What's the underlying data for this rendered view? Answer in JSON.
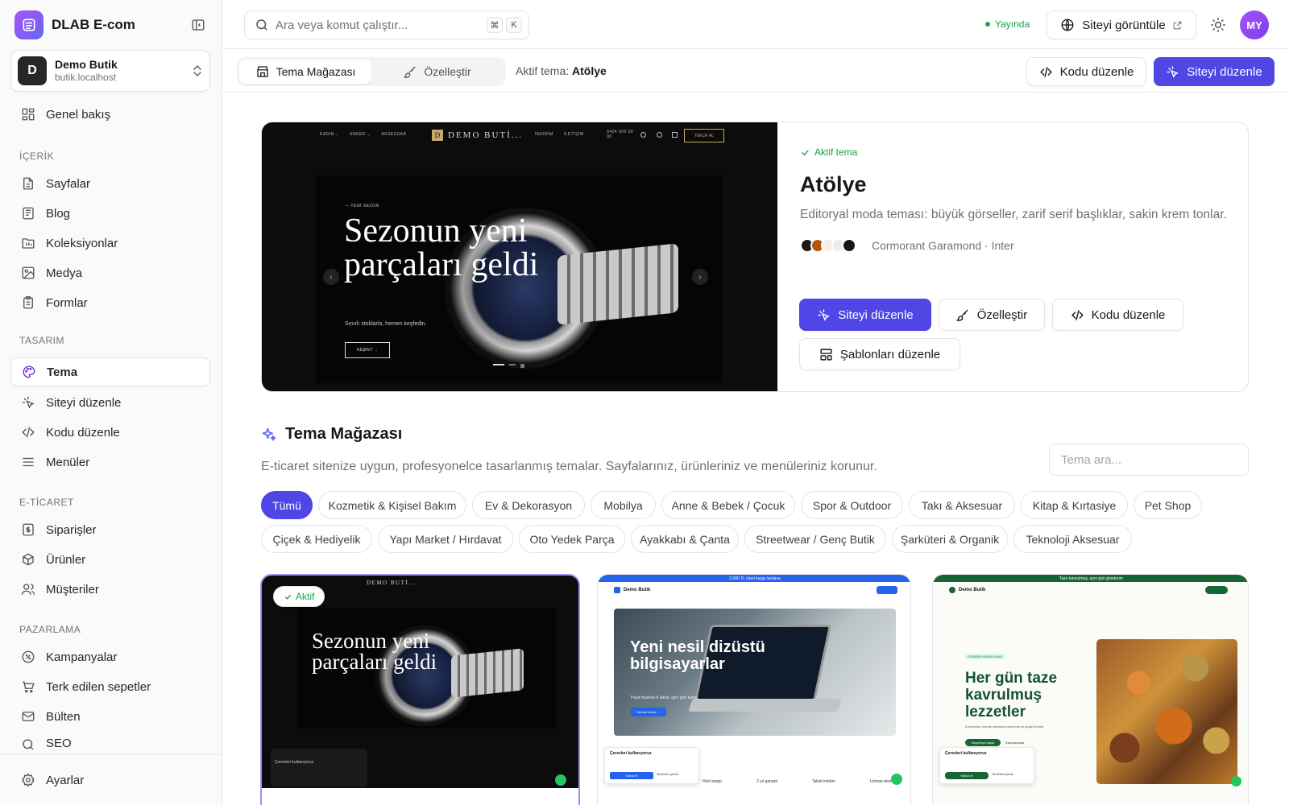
{
  "app": {
    "name": "DLAB E-com"
  },
  "store": {
    "initial": "D",
    "name": "Demo Butik",
    "url": "butik.localhost"
  },
  "nav": {
    "overview": "Genel bakış",
    "content_section": "İÇERİK",
    "pages": "Sayfalar",
    "blog": "Blog",
    "collections": "Koleksiyonlar",
    "media": "Medya",
    "forms": "Formlar",
    "design_section": "TASARIM",
    "theme": "Tema",
    "site_edit": "Siteyi düzenle",
    "code_edit": "Kodu düzenle",
    "menus": "Menüler",
    "commerce_section": "E-TİCARET",
    "orders": "Siparişler",
    "products": "Ürünler",
    "customers": "Müşteriler",
    "marketing_section": "PAZARLAMA",
    "campaigns": "Kampanyalar",
    "abandoned": "Terk edilen sepetler",
    "newsletter": "Bülten",
    "seo": "SEO",
    "settings": "Ayarlar"
  },
  "topbar": {
    "search_placeholder": "Ara veya komut çalıştır...",
    "kbd_cmd": "⌘",
    "kbd_k": "K",
    "status": "Yayında",
    "view_site": "Siteyi görüntüle",
    "avatar": "MY"
  },
  "subbar": {
    "tab_store": "Tema Mağazası",
    "tab_customize": "Özelleştir",
    "active_label": "Aktif tema:",
    "active_value": "Atölye",
    "code_edit": "Kodu düzenle",
    "site_edit": "Siteyi düzenle"
  },
  "hero": {
    "badge": "Aktif tema",
    "title": "Atölye",
    "description": "Editoryal moda teması: büyük görseller, zarif serif başlıklar, sakin krem tonlar.",
    "swatches": [
      "#1c1917",
      "#b45309",
      "#f5f0e6",
      "#fafaf9",
      "#18181b"
    ],
    "fonts": "Cormorant Garamond · Inter",
    "btn_site_edit": "Siteyi düzenle",
    "btn_customize": "Özelleştir",
    "btn_code_edit": "Kodu düzenle",
    "btn_templates": "Şablonları düzenle",
    "preview": {
      "nav_left": [
        "KADIN ⌄",
        "ERKEK ⌄",
        "AKSESUAR"
      ],
      "logo_mark": "D",
      "logo_text": "DEMO BUTİ...",
      "nav_right": [
        "İNDİRİM",
        "İLETİŞİM"
      ],
      "phone": "0424 000 00 00",
      "cta": "TEKLİF AL",
      "kicker": "— YENİ SEZON",
      "headline": "Sezonun yeni parçaları geldi",
      "sub": "Sınırlı stoklarla, hemen keşfedin.",
      "button": "KEŞFET →"
    }
  },
  "store_section": {
    "title": "Tema Mağazası",
    "description": "E-ticaret sitenize uygun, profesyonelce tasarlanmış temalar. Sayfalarınız, ürünleriniz ve menüleriniz korunur.",
    "search_placeholder": "Tema ara..."
  },
  "categories": [
    "Tümü",
    "Kozmetik & Kişisel Bakım",
    "Ev & Dekorasyon",
    "Mobilya",
    "Anne & Bebek / Çocuk",
    "Spor & Outdoor",
    "Takı & Aksesuar",
    "Kitap & Kırtasiye",
    "Pet Shop",
    "Çiçek & Hediyelik",
    "Yapı Market / Hırdavat",
    "Oto Yedek Parça",
    "Ayakkabı & Çanta",
    "Streetwear / Genç Butik",
    "Şarküteri & Organik",
    "Teknoloji Aksesuar"
  ],
  "cards": [
    {
      "badge": "Aktif",
      "headline": "Sezonun yeni parçaları geldi",
      "logo": "DEMO BUTİ...",
      "cookie": "Çerezleri kullanıyoruz"
    },
    {
      "topline": "2.000 TL üzeri kargo bedava",
      "logo": "Demo Butik",
      "headline": "Yeni nesil dizüstü bilgisayarlar",
      "sub": "Peşin fiyatına 6 taksit, aynı gün kargo",
      "button": "Hemen incele →",
      "cookie": "Çerezleri kullanıyoruz",
      "accept": "Kabul et",
      "manage": "Tercihleri yönet",
      "features": [
        "Hızlı kargo",
        "2 yıl garanti",
        "Taksit imkânı",
        "Uzman destek"
      ]
    },
    {
      "topline": "Taze kavrulmuş, aynı gün gönderim",
      "logo": "Demo Butik",
      "kicker": "GÜNDEN KAVRULMUŞ",
      "headline": "Her gün taze kavrulmuş lezzetler",
      "sub": "Kuruyemiş, özenle seçilmiş kuruyemiş ve doğal ürünler.",
      "button": "Alışverişe başla",
      "button2": "Kampanyalar",
      "cookie": "Çerezleri kullanıyoruz",
      "accept": "Kabul et",
      "manage": "Tercihleri yönet"
    }
  ],
  "colors": {
    "primary": "#4f46e5",
    "success": "#16a34a",
    "brand_gradient": [
      "#a855f7",
      "#6366f1"
    ]
  }
}
